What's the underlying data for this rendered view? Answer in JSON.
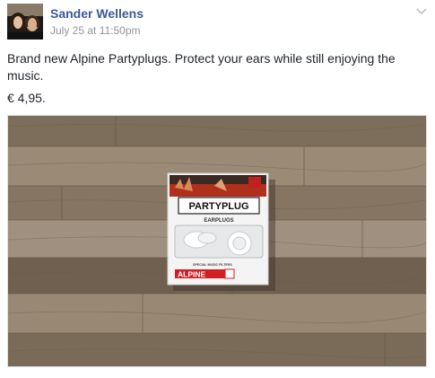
{
  "post": {
    "author": "Sander Wellens",
    "timestamp": "July 25 at 11:50pm",
    "text": "Brand new Alpine Partyplugs. Protect your ears while still enjoying the music.",
    "price": "€ 4,95."
  },
  "photo": {
    "box_brand": "PARTYPLUG",
    "box_subtitle": "EARPLUGS",
    "box_filter_text": "SPECIAL MUSIC FILTERS",
    "box_logo": "ALPINE"
  },
  "colors": {
    "author_link": "#3b5998",
    "timestamp": "#90949c",
    "body_text": "#1d2129"
  },
  "icons": {
    "options": "chevron-down-icon"
  }
}
